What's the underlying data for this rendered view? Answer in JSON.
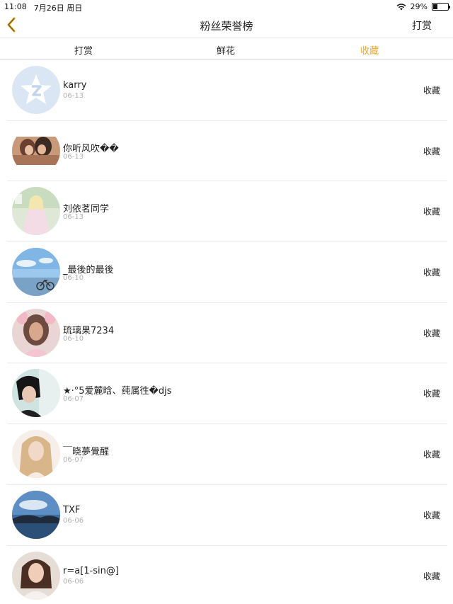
{
  "status": {
    "time": "11:08",
    "date": "7月26日 周日",
    "battery": "29%",
    "battery_level": 0.29
  },
  "nav": {
    "title": "粉丝荣誉榜",
    "action": "打赏"
  },
  "tabs": [
    {
      "label": "打赏"
    },
    {
      "label": "鲜花"
    },
    {
      "label": "收藏",
      "active": true
    }
  ],
  "colors": {
    "accent": "#f0a52a",
    "date": "#b0b0b0"
  },
  "list": [
    {
      "name": "karry",
      "date": "06-13",
      "action": "收藏",
      "avatar_icon": "qq-default-avatar"
    },
    {
      "name": "你听风吹��",
      "date": "06-13",
      "action": "收藏",
      "avatar_icon": "photo-avatar"
    },
    {
      "name": "刘依茗同学",
      "date": "06-13",
      "action": "收藏",
      "avatar_icon": "photo-avatar"
    },
    {
      "name": "_最後的最後",
      "date": "06-10",
      "action": "收藏",
      "avatar_icon": "photo-avatar"
    },
    {
      "name": "琉璃果7234",
      "date": "06-10",
      "action": "收藏",
      "avatar_icon": "photo-avatar"
    },
    {
      "name": "★·°5爱麓晗、莼属徃�djs",
      "date": "06-07",
      "action": "收藏",
      "avatar_icon": "photo-avatar"
    },
    {
      "name": "￣晓夢覺醒",
      "date": "06-07",
      "action": "收藏",
      "avatar_icon": "photo-avatar"
    },
    {
      "name": "TXF",
      "date": "06-06",
      "action": "收藏",
      "avatar_icon": "photo-avatar"
    },
    {
      "name": "r=a[1-sin@]",
      "date": "06-06",
      "action": "收藏",
      "avatar_icon": "photo-avatar"
    }
  ]
}
